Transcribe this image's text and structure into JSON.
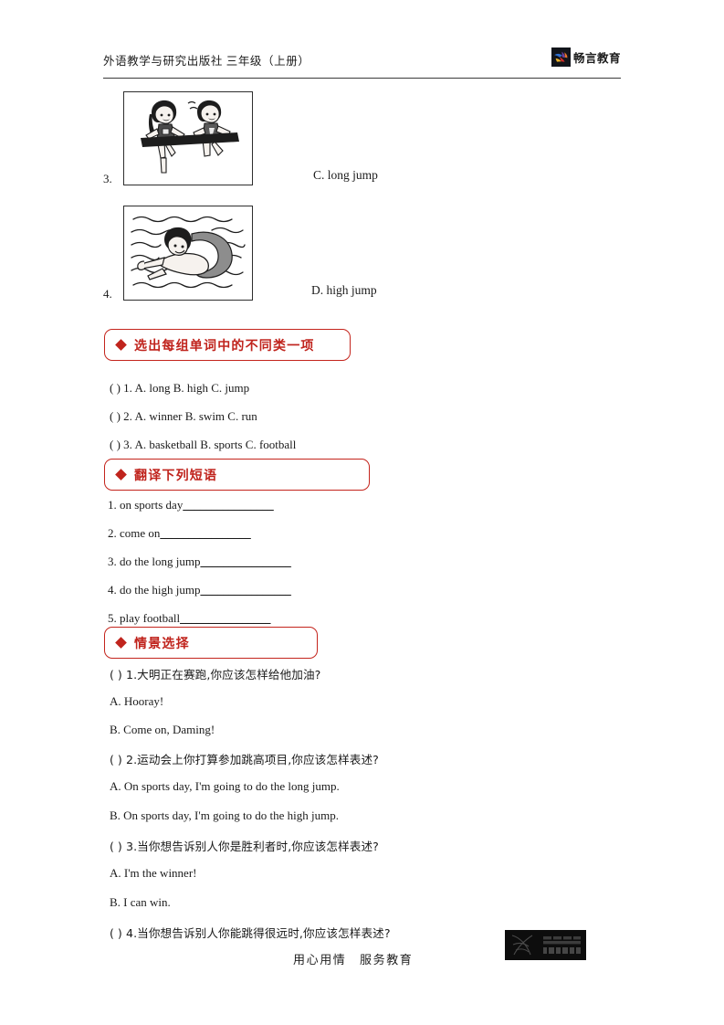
{
  "header": {
    "title": "外语教学与研究出版社  三年级（上册）",
    "brand_name": "畅言教育",
    "brand_icon": "bird-logo-icon"
  },
  "picture_items": [
    {
      "number": "3.",
      "image_alt": "two-children-running-race-illustration",
      "option": "C. long jump"
    },
    {
      "number": "4.",
      "image_alt": "boy-swimming-in-water-illustration",
      "option": "D. high jump"
    }
  ],
  "sections": [
    {
      "id": "odd-one-out",
      "bullet_icon": "red-diamond-icon",
      "title": "选出每组单词中的不同类一项",
      "items": [
        {
          "paren": "(        )",
          "num": "1.",
          "choices": "A. long        B. high        C. jump"
        },
        {
          "paren": "(        )",
          "num": "2.",
          "choices": "A. winner        B. swim        C. run"
        },
        {
          "paren": "(        )",
          "num": "3.",
          "choices": "A. basketball        B. sports        C. football"
        }
      ]
    },
    {
      "id": "translate-phrases",
      "bullet_icon": "red-diamond-icon",
      "title": "翻译下列短语",
      "items": [
        {
          "num": "1.",
          "phrase": "on sports day",
          "blank": "________________"
        },
        {
          "num": "2.",
          "phrase": "come on",
          "blank": "________________"
        },
        {
          "num": "3.",
          "phrase": "do the long jump",
          "blank": "________________"
        },
        {
          "num": "4.",
          "phrase": "do the high jump",
          "blank": "________________"
        },
        {
          "num": "5.",
          "phrase": "play football",
          "blank": "________________"
        }
      ]
    },
    {
      "id": "situational-choice",
      "bullet_icon": "red-diamond-icon",
      "title": "情景选择",
      "questions": [
        {
          "paren": "(        )",
          "num": "1.",
          "prompt": "大明正在赛跑,你应该怎样给他加油?",
          "options": [
            "A. Hooray!",
            "B. Come on, Daming!"
          ]
        },
        {
          "paren": "(        )",
          "num": "2.",
          "prompt": "运动会上你打算参加跳高项目,你应该怎样表述?",
          "options": [
            "A. On sports day, I'm going to do the long jump.",
            "B. On sports day, I'm going to do the high jump."
          ]
        },
        {
          "paren": "(        )",
          "num": "3.",
          "prompt": "当你想告诉别人你是胜利者时,你应该怎样表述?",
          "options": [
            "A. I'm the winner!",
            "B. I can win."
          ]
        },
        {
          "paren": "(        )",
          "num": "4.",
          "prompt": "当你想告诉别人你能跳得很远时,你应该怎样表述?",
          "options": []
        }
      ]
    }
  ],
  "footer": {
    "slogan": "用心用情　服务教育",
    "logo_icon": "iflytek-logo-icon",
    "logo_cn": "科大讯飞",
    "logo_en": "IFLYTEK"
  },
  "colors": {
    "accent_red": "#c0241d",
    "text": "#1a1a1a",
    "rule": "#3a3a3a"
  }
}
